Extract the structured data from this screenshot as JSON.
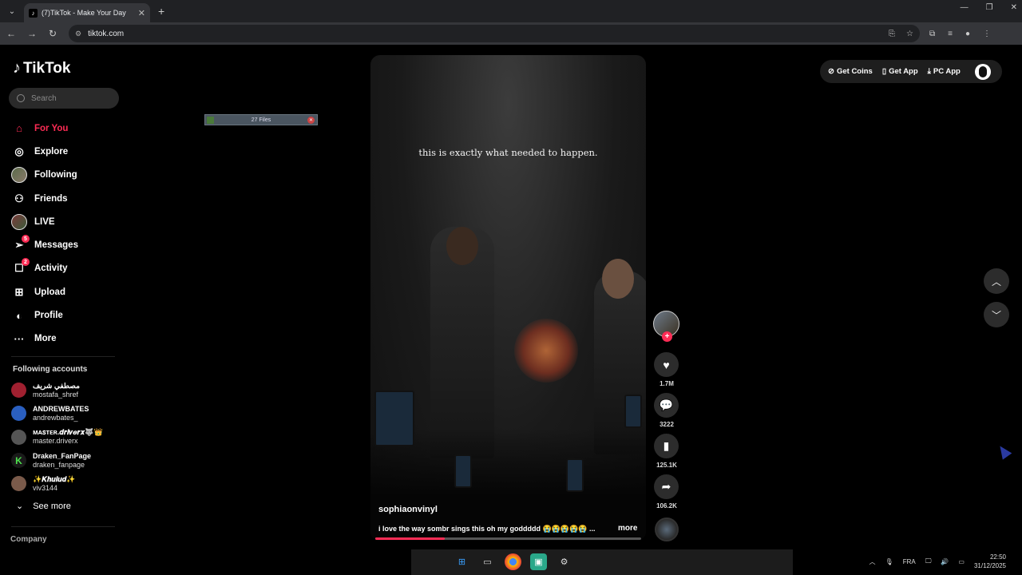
{
  "browser": {
    "tab_title": "(7)TikTok - Make Your Day",
    "tab_close": "✕",
    "new_tab": "+",
    "url": "tiktok.com",
    "win_controls": [
      "—",
      "❐",
      "✕"
    ]
  },
  "sidebar": {
    "logo": "TikTok",
    "search_placeholder": "Search",
    "nav": [
      {
        "label": "For You",
        "icon": "home-icon",
        "active": true
      },
      {
        "label": "Explore",
        "icon": "compass-icon"
      },
      {
        "label": "Following",
        "icon": "following-avatar"
      },
      {
        "label": "Friends",
        "icon": "friends-icon"
      },
      {
        "label": "LIVE",
        "icon": "live-avatar"
      },
      {
        "label": "Messages",
        "icon": "messages-icon",
        "badge": "5"
      },
      {
        "label": "Activity",
        "icon": "activity-icon",
        "badge": "2"
      },
      {
        "label": "Upload",
        "icon": "upload-icon"
      },
      {
        "label": "Profile",
        "icon": "profile-icon"
      },
      {
        "label": "More",
        "icon": "more-icon"
      }
    ],
    "following_title": "Following accounts",
    "accounts": [
      {
        "name": "مصطفي شريف",
        "handle": "mostafa_shref",
        "color": "#a02030"
      },
      {
        "name": "ANDREWBATES",
        "handle": "andrewbates_",
        "color": "#2a5fc0"
      },
      {
        "name": "ᴍᴀꜱᴛᴇʀ.𝒅𝒓𝒊𝒗𝒆𝒓𝒙🐺👑",
        "handle": "master.driverx",
        "color": "#555"
      },
      {
        "name": "Draken_FanPage",
        "handle": "draken_fanpage",
        "color": "#1a1a1a"
      },
      {
        "name": "✨𝑲𝒉𝒖𝒍𝒖𝒅✨",
        "handle": "viv3144",
        "color": "#7a5a4a"
      }
    ],
    "see_more": "See more",
    "company": "Company"
  },
  "files_widget": {
    "label": "27 Files"
  },
  "video": {
    "overlay_text": "this is exactly what needed to happen.",
    "author": "sophiaonvinyl",
    "description": "i love the way sombr sings this oh my goddddd 😭😭😭😭😭 ...",
    "more": "more",
    "progress": 0.26
  },
  "actions": {
    "likes": "1.7M",
    "comments": "3222",
    "saves": "125.1K",
    "shares": "106.2K"
  },
  "top_right": {
    "get_coins": "Get Coins",
    "get_app": "Get App",
    "pc_app": "PC App"
  },
  "taskbar": {
    "lang": "FRA",
    "time": "22:50",
    "date": "31/12/2025"
  },
  "colors": {
    "accent": "#fe2c55"
  }
}
